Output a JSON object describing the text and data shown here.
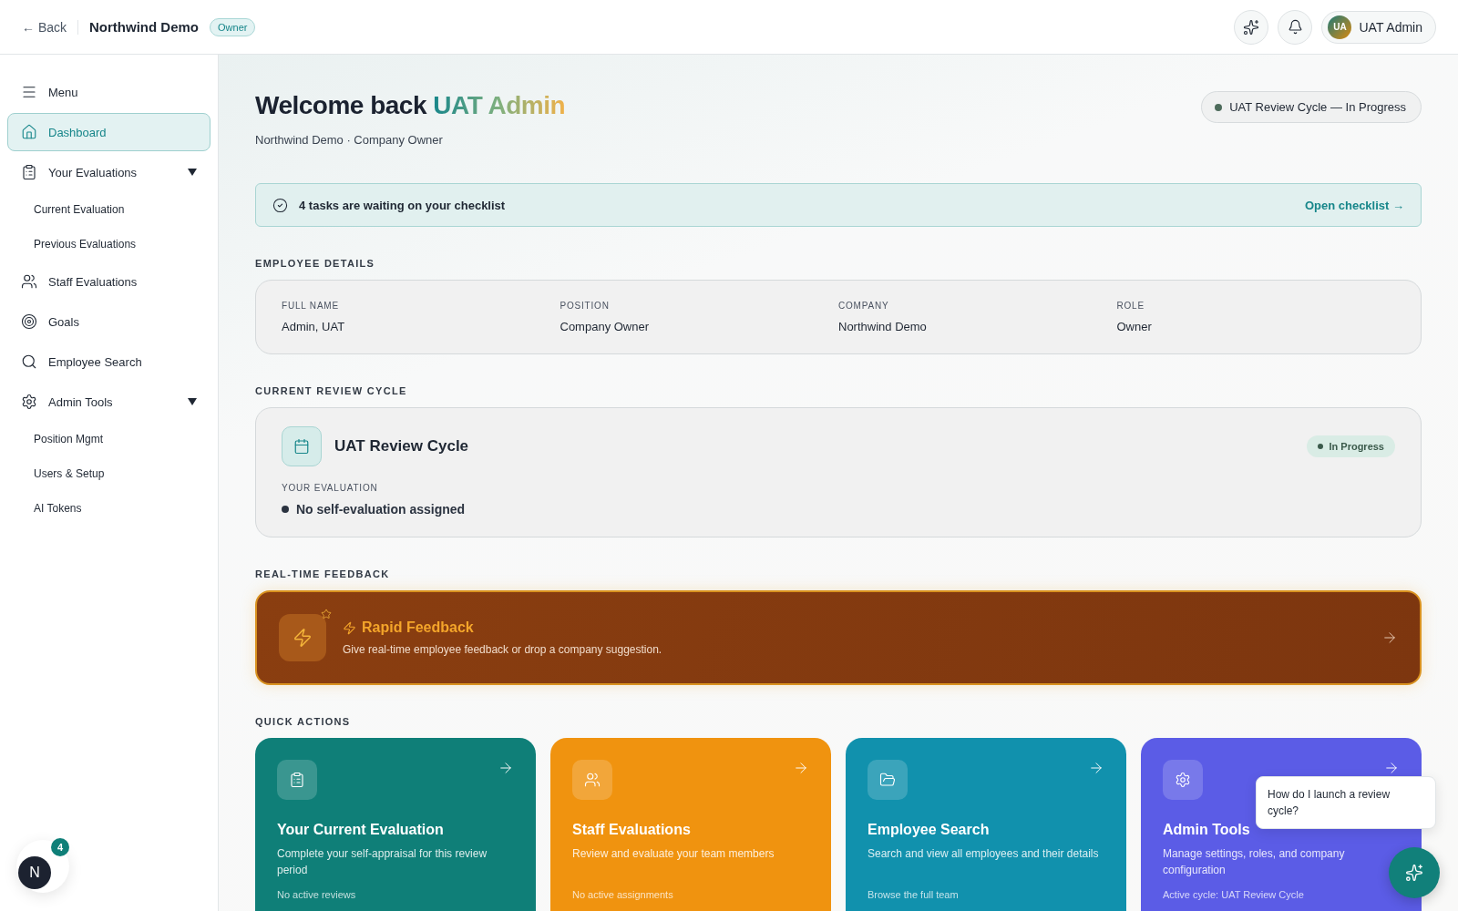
{
  "header": {
    "back": "← Back",
    "company": "Northwind Demo",
    "role_badge": "Owner",
    "user": {
      "initials": "UA",
      "name": "UAT Admin"
    }
  },
  "sidebar": {
    "menu_label": "Menu",
    "items": [
      {
        "label": "Dashboard",
        "selected": true
      },
      {
        "label": "Your Evaluations",
        "selected": false,
        "expanded": true,
        "children": [
          {
            "label": "Current Evaluation",
            "selected": false
          },
          {
            "label": "Previous Evaluations",
            "selected": false
          }
        ]
      },
      {
        "label": "Staff Evaluations",
        "selected": false
      },
      {
        "label": "Goals",
        "selected": false
      },
      {
        "label": "Employee Search",
        "selected": false
      },
      {
        "label": "Admin Tools",
        "selected": false,
        "expanded": true,
        "children": [
          {
            "label": "Position Mgmt",
            "selected": false
          },
          {
            "label": "Users & Setup",
            "selected": false
          },
          {
            "label": "AI Tokens",
            "selected": false
          }
        ]
      }
    ]
  },
  "greeting": {
    "prefix": "Welcome back",
    "name": "UAT Admin",
    "subtitle": "Northwind Demo · Company Owner",
    "cycle_pill": "UAT Review Cycle — In Progress"
  },
  "checklist": {
    "text": "4 tasks are waiting on your checklist",
    "link": "Open checklist →"
  },
  "employee_details": {
    "heading": "EMPLOYEE DETAILS",
    "fields": [
      {
        "label": "FULL NAME",
        "value": "Admin, UAT"
      },
      {
        "label": "POSITION",
        "value": "Company Owner"
      },
      {
        "label": "COMPANY",
        "value": "Northwind Demo"
      },
      {
        "label": "ROLE",
        "value": "Owner"
      }
    ]
  },
  "review_cycle": {
    "heading": "CURRENT REVIEW CYCLE",
    "title": "UAT Review Cycle",
    "status": "In Progress",
    "eval_label": "YOUR EVALUATION",
    "eval_status": "No self-evaluation assigned"
  },
  "feedback": {
    "heading": "REAL-TIME FEEDBACK",
    "title": "Rapid Feedback",
    "description": "Give real-time employee feedback or drop a company suggestion."
  },
  "quick_actions": {
    "heading": "QUICK ACTIONS",
    "cards": [
      {
        "title": "Your Current Evaluation",
        "description": "Complete your self-appraisal for this review period",
        "footer": "No active reviews",
        "color": "#0f7f78"
      },
      {
        "title": "Staff Evaluations",
        "description": "Review and evaluate your team members",
        "footer": "No active assignments",
        "color": "#f0930f"
      },
      {
        "title": "Employee Search",
        "description": "Search and view all employees and their details",
        "footer": "Browse the full team",
        "color": "#1191ad"
      },
      {
        "title": "Admin Tools",
        "description": "Manage settings, roles, and company configuration",
        "footer": "Active cycle: UAT Review Cycle",
        "color": "#5b5ce6"
      }
    ]
  },
  "chat": {
    "bubble": "How do I launch a review cycle?"
  },
  "dev_badge": {
    "letter": "N",
    "count": "4"
  }
}
